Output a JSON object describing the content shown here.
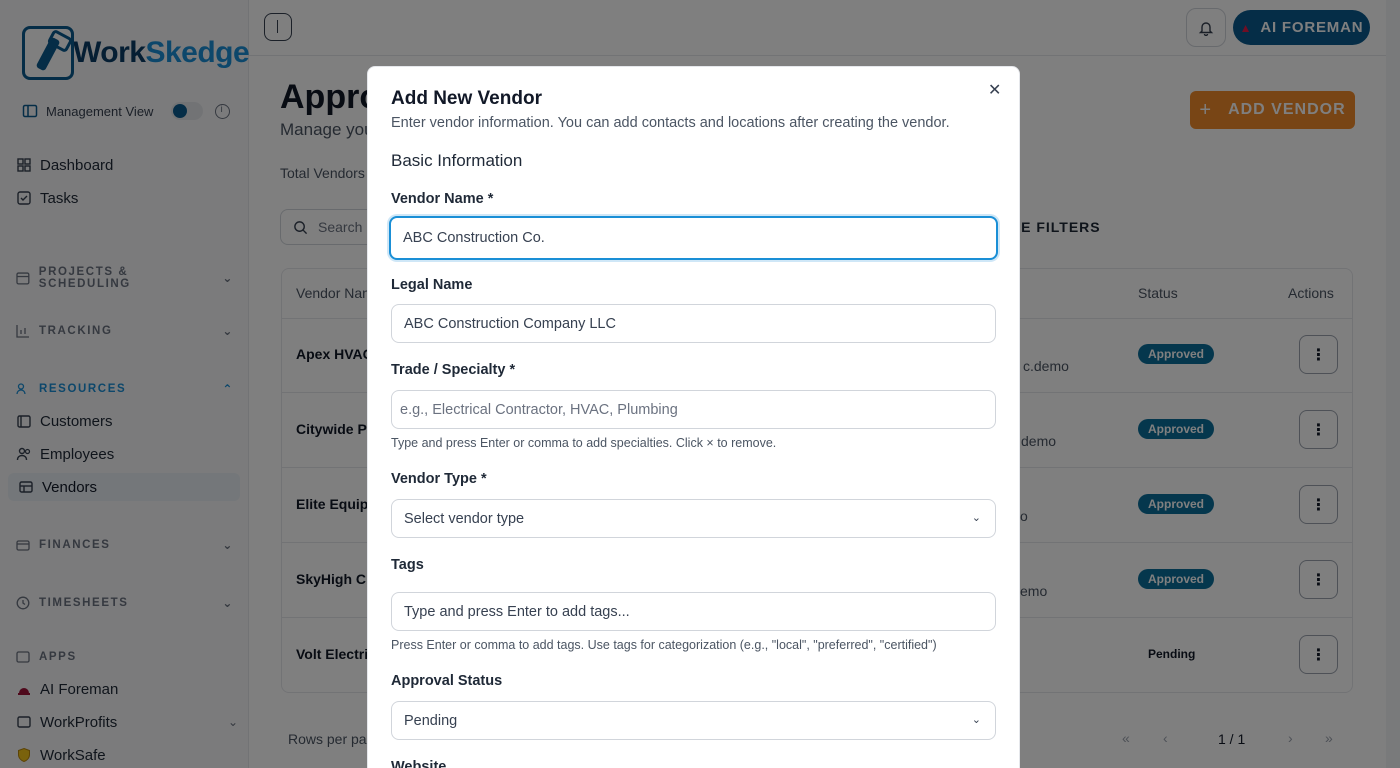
{
  "sidebar": {
    "logo": {
      "part1": "Work",
      "part2": "Skedge"
    },
    "management_view": "Management View",
    "items": {
      "dashboard": "Dashboard",
      "tasks": "Tasks",
      "customers": "Customers",
      "employees": "Employees",
      "vendors": "Vendors",
      "ai_foreman": "AI Foreman",
      "workprofits": "WorkProfits",
      "worksafe": "WorkSafe"
    },
    "sections": {
      "projects": "PROJECTS & SCHEDULING",
      "tracking": "TRACKING",
      "resources": "RESOURCES",
      "finances": "FINANCES",
      "timesheets": "TIMESHEETS",
      "apps": "APPS"
    }
  },
  "header": {
    "ai_button": "AI FOREMAN"
  },
  "page": {
    "title": "Appro",
    "subtitle": "Manage you",
    "add_vendor": "ADD VENDOR",
    "total": "Total Vendors",
    "search_placeholder": "Search",
    "more_filters": "RE FILTERS"
  },
  "table": {
    "headers": {
      "name": "Vendor Nan",
      "status": "Status",
      "actions": "Actions"
    },
    "rows": [
      {
        "name": "Apex HVAC",
        "email": "c.demo",
        "status": "Approved"
      },
      {
        "name": "Citywide P",
        "email": "demo",
        "status": "Approved"
      },
      {
        "name": "Elite Equip",
        "email": "o",
        "status": "Approved"
      },
      {
        "name": "SkyHigh C",
        "email": "emo",
        "status": "Approved"
      },
      {
        "name": "Volt Electri",
        "email": "",
        "status": "Pending"
      }
    ]
  },
  "pager": {
    "rows_label": "Rows per pa",
    "count": "1 / 1"
  },
  "modal": {
    "title": "Add New Vendor",
    "description": "Enter vendor information. You can add contacts and locations after creating the vendor.",
    "section": "Basic Information",
    "vendor_name_label": "Vendor Name *",
    "vendor_name_value": "ABC Construction Co.",
    "legal_name_label": "Legal Name",
    "legal_name_value": "ABC Construction Company LLC",
    "trade_label": "Trade / Specialty *",
    "trade_placeholder": "e.g., Electrical Contractor, HVAC, Plumbing",
    "trade_help": "Type and press Enter or comma to add specialties. Click × to remove.",
    "vendor_type_label": "Vendor Type *",
    "vendor_type_value": "Select vendor type",
    "tags_label": "Tags",
    "tags_placeholder": "Type and press Enter to add tags...",
    "tags_help": "Press Enter or comma to add tags. Use tags for categorization (e.g., \"local\", \"preferred\", \"certified\")",
    "approval_label": "Approval Status",
    "approval_value": "Pending",
    "website_label": "Website"
  },
  "colors": {
    "brand": "#0a5b8f",
    "accent": "#1a8fd6",
    "add_button": "#f08a2b"
  }
}
